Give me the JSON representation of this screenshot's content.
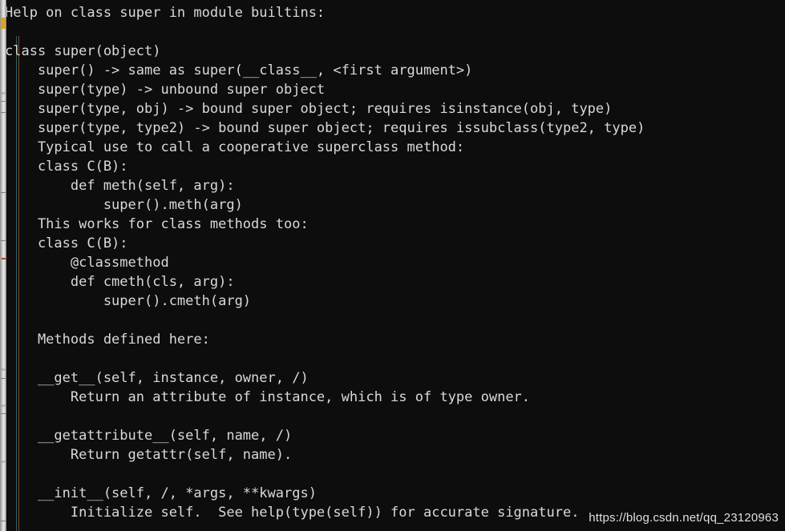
{
  "window": {
    "background_color": "#0d0d0d",
    "text_color": "#d8d9da",
    "guide_teal_color": "#2e5f72",
    "guide_amber_color": "#7a5220"
  },
  "console": {
    "title": "Help on class super in module builtins:",
    "lines": [
      "Help on class super in module builtins:",
      "",
      "class super(object)",
      " |  super() -> same as super(__class__, <first argument>)",
      " |  super(type) -> unbound super object",
      " |  super(type, obj) -> bound super object; requires isinstance(obj, type)",
      " |  super(type, type2) -> bound super object; requires issubclass(type2, type)",
      " |  Typical use to call a cooperative superclass method:",
      " |  class C(B):",
      " |      def meth(self, arg):",
      " |          super().meth(arg)",
      " |  This works for class methods too:",
      " |  class C(B):",
      " |      @classmethod",
      " |      def cmeth(cls, arg):",
      " |          super().cmeth(arg)",
      " |",
      " |  Methods defined here:",
      " |",
      " |  __get__(self, instance, owner, /)",
      " |      Return an attribute of instance, which is of type owner.",
      " |",
      " |  __getattribute__(self, name, /)",
      " |      Return getattr(self, name).",
      " |",
      " |  __init__(self, /, *args, **kwargs)",
      " |      Initialize self.  See help(type(self)) for accurate signature."
    ],
    "rendered_lines": [
      "Help on class super in module builtins:",
      "",
      "class super(object)",
      "    super() -> same as super(__class__, <first argument>)",
      "    super(type) -> unbound super object",
      "    super(type, obj) -> bound super object; requires isinstance(obj, type)",
      "    super(type, type2) -> bound super object; requires issubclass(type2, type)",
      "    Typical use to call a cooperative superclass method:",
      "    class C(B):",
      "        def meth(self, arg):",
      "            super().meth(arg)",
      "    This works for class methods too:",
      "    class C(B):",
      "        @classmethod",
      "        def cmeth(cls, arg):",
      "            super().cmeth(arg)",
      "",
      "    Methods defined here:",
      "",
      "    __get__(self, instance, owner, /)",
      "        Return an attribute of instance, which is of type owner.",
      "",
      "    __getattribute__(self, name, /)",
      "        Return getattr(self, name).",
      "",
      "    __init__(self, /, *args, **kwargs)",
      "        Initialize self.  See help(type(self)) for accurate signature."
    ]
  },
  "watermark": {
    "text": "https://blog.csdn.net/qq_23120963"
  },
  "gutter": {
    "amber_marker": "bookmark-marker",
    "red_marker": "error-marker"
  }
}
